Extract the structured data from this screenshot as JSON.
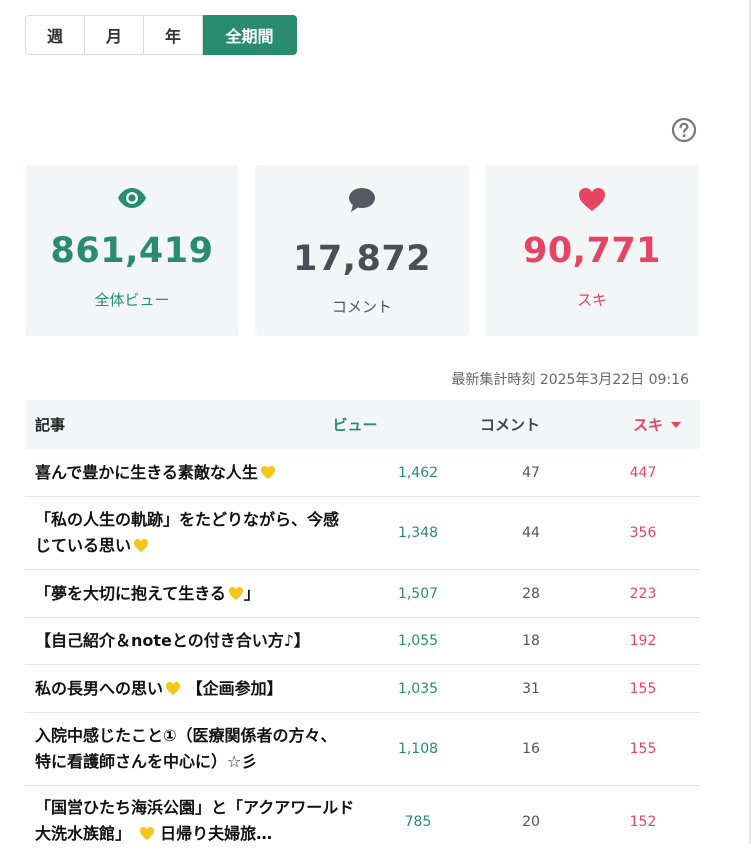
{
  "period_tabs": [
    {
      "label": "週",
      "active": false
    },
    {
      "label": "月",
      "active": false
    },
    {
      "label": "年",
      "active": false
    },
    {
      "label": "全期間",
      "active": true
    }
  ],
  "stats": {
    "views": {
      "icon": "eye-icon",
      "value": "861,419",
      "label": "全体ビュー"
    },
    "comments": {
      "icon": "speech-bubble-icon",
      "value": "17,872",
      "label": "コメント"
    },
    "likes": {
      "icon": "heart-icon",
      "value": "90,771",
      "label": "スキ"
    }
  },
  "timestamp": "最新集計時刻 2025年3月22日 09:16",
  "table": {
    "headers": {
      "title": "記事",
      "views": "ビュー",
      "comments": "コメント",
      "likes": "スキ"
    },
    "rows": [
      {
        "title": "喜んで豊かに生きる素敵な人生",
        "title_suffix": "",
        "views": "1,462",
        "comments": "47",
        "likes": "447"
      },
      {
        "title": "「私の人生の軌跡」をたどりながら、今感じている思い",
        "title_suffix": "",
        "views": "1,348",
        "comments": "44",
        "likes": "356"
      },
      {
        "title": "「夢を大切に抱えて生きる",
        "title_suffix": "」",
        "views": "1,507",
        "comments": "28",
        "likes": "223"
      },
      {
        "title": "【自己紹介＆noteとの付き合い方♪】",
        "title_suffix": "",
        "views": "1,055",
        "comments": "18",
        "likes": "192"
      },
      {
        "title": "私の長男への思い",
        "title_suffix": "【企画参加】",
        "views": "1,035",
        "comments": "31",
        "likes": "155"
      },
      {
        "title": "入院中感じたこと①（医療関係者の方々、特に看護師さんを中心に）☆彡",
        "title_suffix": "",
        "views": "1,108",
        "comments": "16",
        "likes": "155"
      },
      {
        "title": "「国営ひたち海浜公園」と「アクアワールド大洗水族館」",
        "title_suffix": "日帰り夫婦旅…",
        "views": "785",
        "comments": "20",
        "likes": "152"
      }
    ]
  },
  "colors": {
    "accent_green": "#2a8c6f",
    "like_red": "#e64462",
    "heart_yellow": "#f5c518"
  }
}
